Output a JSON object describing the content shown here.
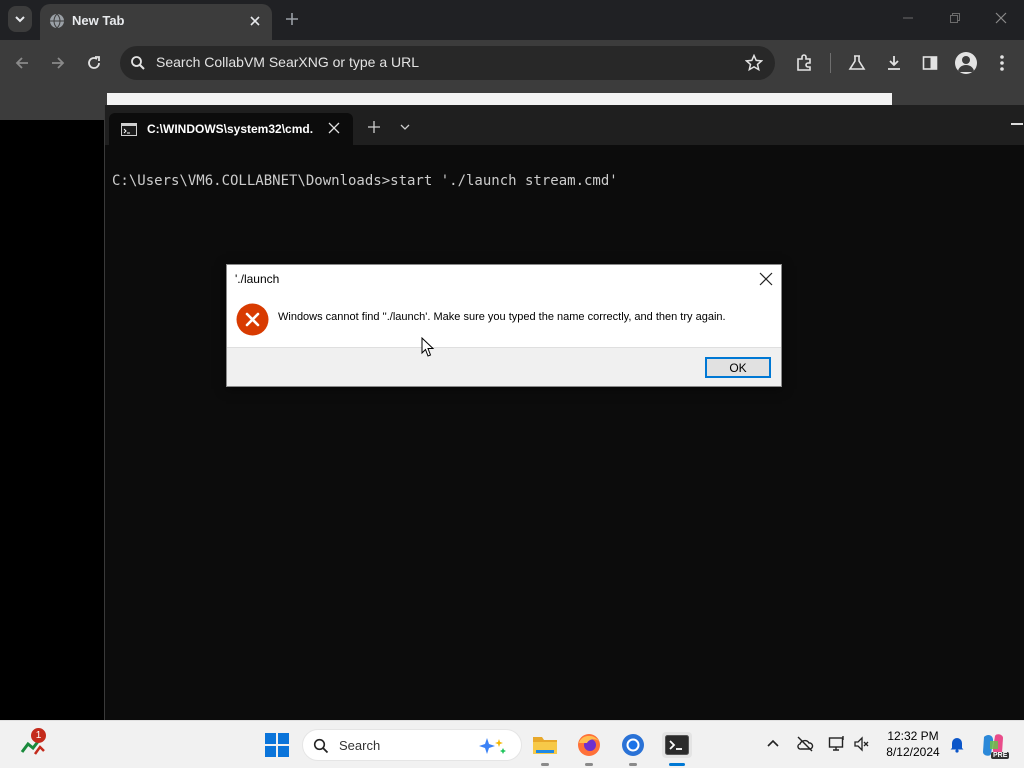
{
  "browser": {
    "tab_title": "New Tab",
    "omnibox_text": "Search CollabVM SearXNG or type a URL"
  },
  "terminal": {
    "tab_title": "C:\\WINDOWS\\system32\\cmd.",
    "line": "C:\\Users\\VM6.COLLABNET\\Downloads>start './launch stream.cmd'"
  },
  "dialog": {
    "title": "'./launch",
    "message": "Windows cannot find ''./launch'. Make sure you typed the name correctly, and then try again.",
    "ok_label": "OK"
  },
  "taskbar": {
    "widget_badge": "1",
    "search_label": "Search",
    "time": "12:32 PM",
    "date": "8/12/2024",
    "copilot_badge": "PRE"
  },
  "icons": {
    "tab_search": "chevron-down-icon",
    "favicon": "globe-icon",
    "error": "error-x-icon",
    "start": "windows-logo-icon"
  },
  "colors": {
    "chrome_dark": "#202124",
    "chrome_toolbar": "#3c3c3c",
    "terminal_bg": "#0c0c0c",
    "error_red": "#d83b01",
    "accent_blue": "#0078d4"
  }
}
